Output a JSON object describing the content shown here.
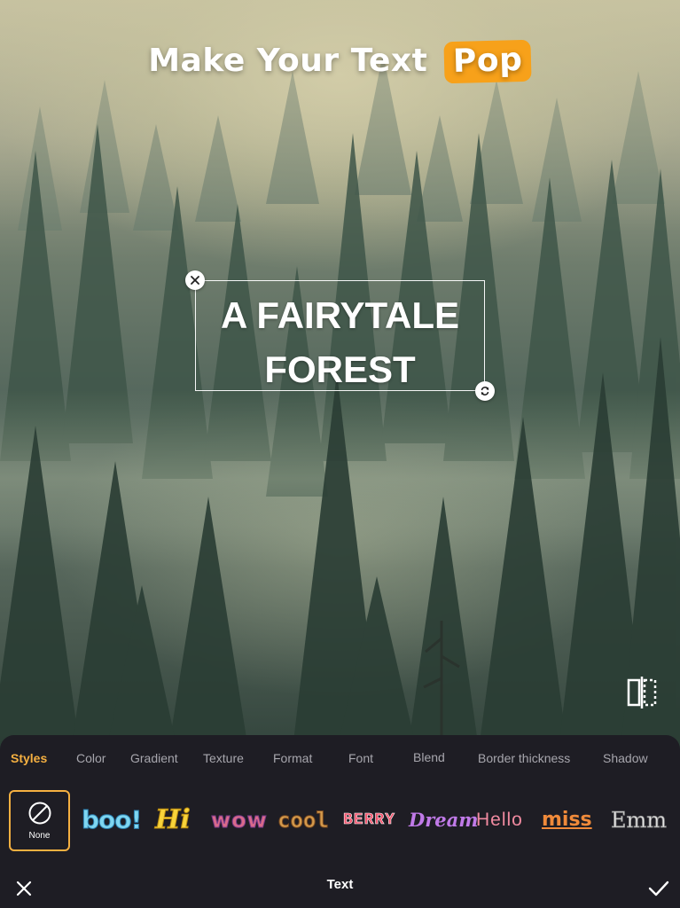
{
  "canvas": {
    "headline": {
      "text": "Make Your Text",
      "highlight": "Pop",
      "highlight_color": "#f7a11a"
    },
    "text_layer": {
      "line1": "A FAIRYTALE",
      "line2": "FOREST"
    }
  },
  "panel": {
    "tabs": [
      {
        "label": "Styles",
        "active": true
      },
      {
        "label": "Color"
      },
      {
        "label": "Gradient"
      },
      {
        "label": "Texture"
      },
      {
        "label": "Format"
      },
      {
        "label": "Font"
      },
      {
        "label": "Blend"
      },
      {
        "label": "Border thickness"
      },
      {
        "label": "Shadow"
      }
    ],
    "styles": {
      "none_label": "None",
      "items": [
        "boo!",
        "Hi",
        "wow",
        "cool",
        "BERRY",
        "Dream",
        "Hello",
        "miss",
        "Emm"
      ]
    },
    "bottom_bar": {
      "title": "Text"
    },
    "accent_color": "#f5b041"
  }
}
